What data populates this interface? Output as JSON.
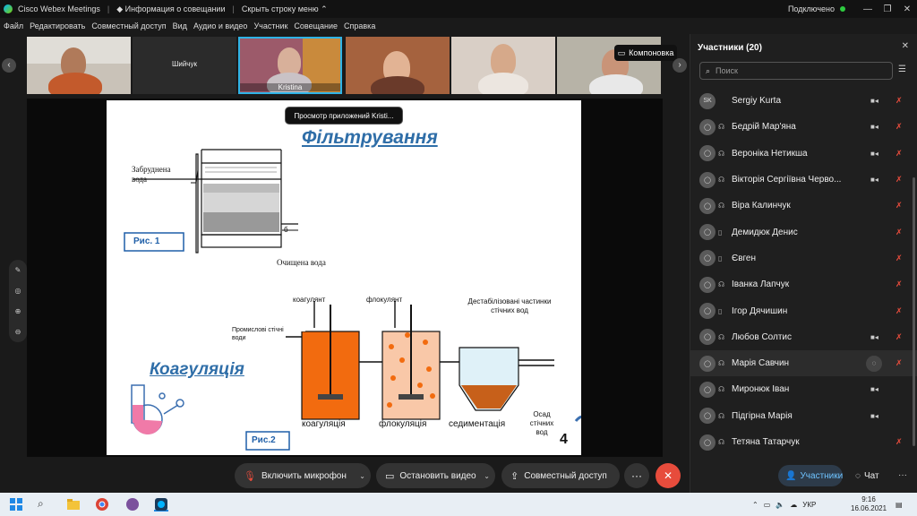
{
  "titlebar": {
    "app_name": "Cisco Webex Meetings",
    "meeting_info": "Информация о совещании",
    "hide_menu": "Скрыть строку меню",
    "status": "Подключено"
  },
  "menu": [
    "Файл",
    "Редактировать",
    "Совместный доступ",
    "Вид",
    "Аудио и видео",
    "Участник",
    "Совещание",
    "Справка"
  ],
  "video_tiles": [
    {
      "label": ""
    },
    {
      "label": "Шийчук"
    },
    {
      "label": "Kristina"
    },
    {
      "label": ""
    },
    {
      "label": ""
    },
    {
      "label": ""
    }
  ],
  "layout_button": "Компоновка",
  "tooltip": "Просмотр приложений Kristi...",
  "slide": {
    "title_top": "Фільтрування",
    "dirty_water": "Забруднена вода",
    "clean_water": "Очищена вода",
    "label_b": "б",
    "fig1": "Рис. 1",
    "coagulant": "коагулянт",
    "flocculant": "флокулянт",
    "destabilized": "Дестабілізовані частинки стічних вод",
    "industrial": "Промислові стічні води",
    "title_bottom": "Коагуляція",
    "coag": "коагуляція",
    "floc": "флокуляція",
    "sed": "седиментація",
    "sludge": "Осад стічних вод",
    "fig2": "Рис.2",
    "page": "4"
  },
  "controls": {
    "mic": "Включить микрофон",
    "video": "Остановить видео",
    "share": "Совместный доступ",
    "more": "···",
    "end": "✕"
  },
  "panel": {
    "title": "Участники (20)",
    "search_placeholder": "Поиск",
    "participants": [
      {
        "name": "Sergiy Kurta",
        "initials": "SK",
        "cam": true,
        "highlight": false
      },
      {
        "name": "Бедрій Мар'яна",
        "initials": "",
        "cam": true,
        "highlight": false
      },
      {
        "name": "Вероніка Нетикша",
        "initials": "",
        "cam": true,
        "highlight": false
      },
      {
        "name": "Вікторія Сергіївна Черво...",
        "initials": "",
        "cam": true,
        "highlight": false
      },
      {
        "name": "Віра Калинчук",
        "initials": "",
        "cam": false,
        "highlight": false
      },
      {
        "name": "Демидюк Денис",
        "initials": "",
        "cam": false,
        "highlight": false
      },
      {
        "name": "Євген",
        "initials": "",
        "cam": false,
        "highlight": false
      },
      {
        "name": "Іванка Лапчук",
        "initials": "",
        "cam": false,
        "highlight": false
      },
      {
        "name": "Ігор Дячишин",
        "initials": "",
        "cam": false,
        "highlight": false
      },
      {
        "name": "Любов Солтис",
        "initials": "",
        "cam": true,
        "highlight": false
      },
      {
        "name": "Марія Савчин",
        "initials": "",
        "cam": false,
        "highlight": true
      },
      {
        "name": "Миронюк Іван",
        "initials": "",
        "cam": true,
        "highlight": false
      },
      {
        "name": "Підгірна Марія",
        "initials": "",
        "cam": true,
        "highlight": false
      },
      {
        "name": "Тетяна Татарчук",
        "initials": "",
        "cam": false,
        "highlight": false
      }
    ],
    "tab_participants": "Участники",
    "tab_chat": "Чат"
  },
  "taskbar": {
    "lang": "УКР",
    "time": "9:16",
    "date": "16.06.2021"
  },
  "colors": {
    "accent": "#2fb3e6",
    "danger": "#e74c3c",
    "orange": "#f26b0f"
  }
}
